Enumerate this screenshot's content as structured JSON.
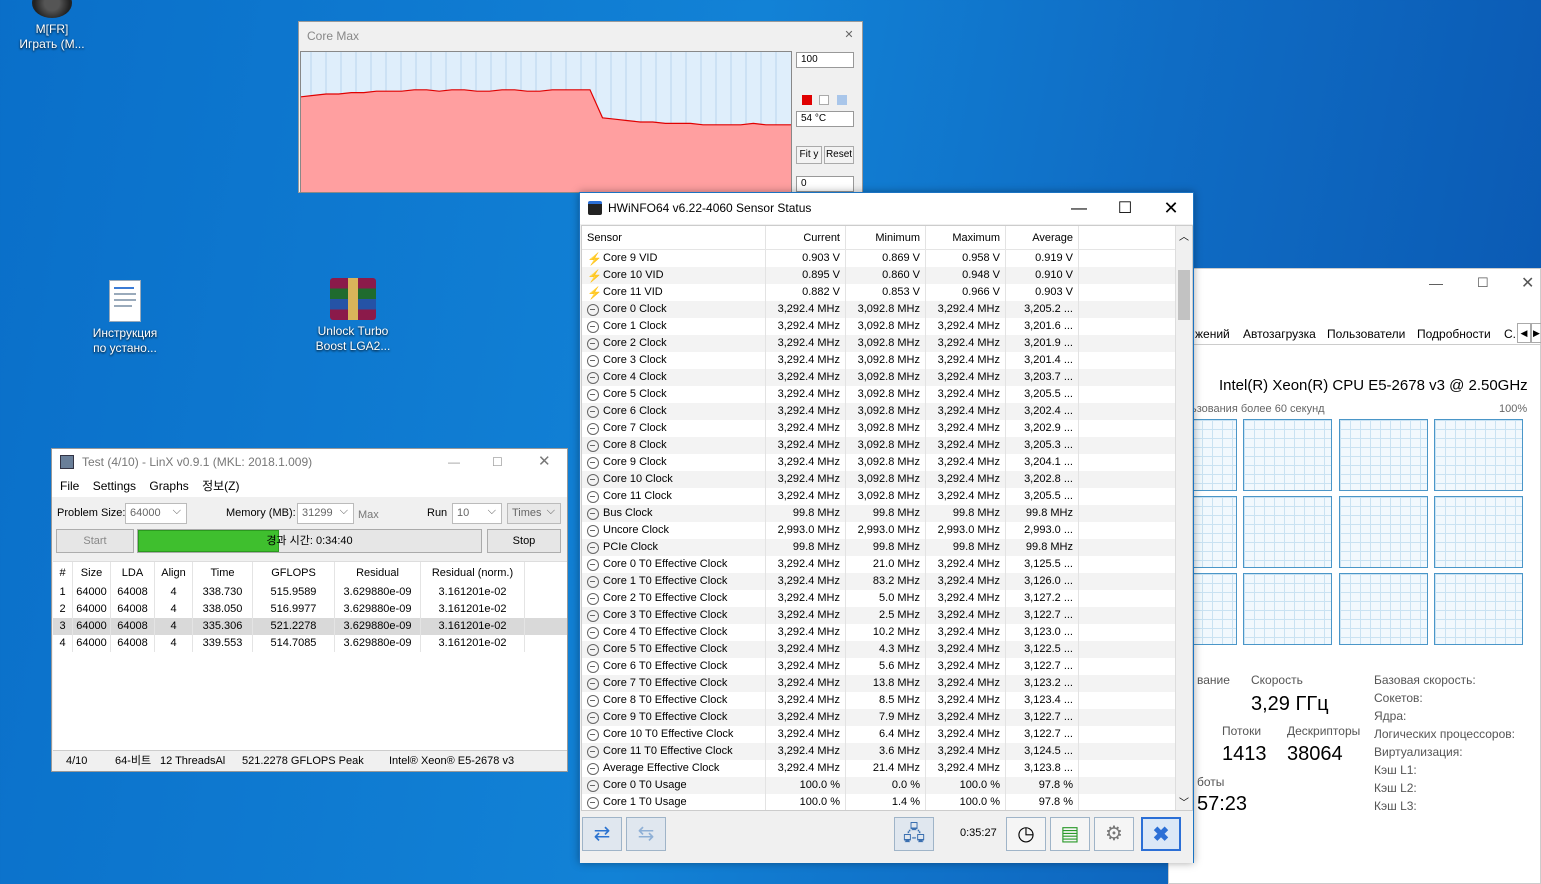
{
  "desktop": {
    "icons": [
      {
        "label_line1": "M[FR]",
        "label_line2": "Играть (М..."
      },
      {
        "label_line1": "Инструкция",
        "label_line2": "по устано..."
      },
      {
        "label_line1": "Unlock Turbo",
        "label_line2": "Boost LGA2..."
      }
    ]
  },
  "core_max": {
    "title": "Core Max",
    "max_value": "100",
    "current_temp": "54 °C",
    "min_value": "0",
    "fit_label": "Fit y",
    "reset_label": "Reset",
    "colors": {
      "line": "#e00000",
      "fill": "#ff9fa0",
      "background": "#dfeefb"
    },
    "series_levels": [
      0.68,
      0.69,
      0.7,
      0.7,
      0.71,
      0.71,
      0.72,
      0.72,
      0.72,
      0.73,
      0.73,
      0.72,
      0.73,
      0.73,
      0.72,
      0.72,
      0.73,
      0.73,
      0.72,
      0.72,
      0.73,
      0.73,
      0.73,
      0.73,
      0.53,
      0.52,
      0.51,
      0.5,
      0.5,
      0.49,
      0.49,
      0.49,
      0.48,
      0.48,
      0.48,
      0.48,
      0.49,
      0.48,
      0.48,
      0.48
    ]
  },
  "linx": {
    "title": "Test (4/10) - LinX v0.9.1 (MKL: 2018.1.009)",
    "menu": [
      "File",
      "Settings",
      "Graphs",
      "정보(Z)"
    ],
    "problem_size_label": "Problem Size:",
    "problem_size": "64000",
    "memory_label": "Memory (MB):",
    "memory": "31299",
    "max_label": "Max",
    "run_label": "Run",
    "run_value": "10",
    "run_unit": "Times",
    "start_label": "Start",
    "stop_label": "Stop",
    "progress_text": "경과 시간: 0:34:40",
    "progress_fraction": 0.41,
    "columns": [
      "#",
      "Size",
      "LDA",
      "Align",
      "Time",
      "GFLOPS",
      "Residual",
      "Residual (norm.)"
    ],
    "rows": [
      [
        "1",
        "64000",
        "64008",
        "4",
        "338.730",
        "515.9589",
        "3.629880e-09",
        "3.161201e-02"
      ],
      [
        "2",
        "64000",
        "64008",
        "4",
        "338.050",
        "516.9977",
        "3.629880e-09",
        "3.161201e-02"
      ],
      [
        "3",
        "64000",
        "64008",
        "4",
        "335.306",
        "521.2278",
        "3.629880e-09",
        "3.161201e-02"
      ],
      [
        "4",
        "64000",
        "64008",
        "4",
        "339.553",
        "514.7085",
        "3.629880e-09",
        "3.161201e-02"
      ]
    ],
    "status": [
      "4/10",
      "64-비트",
      "12 ThreadsAl",
      "521.2278 GFLOPS Peak",
      "Intel® Xeon® E5-2678 v3"
    ]
  },
  "taskmgr": {
    "tabs": [
      "жений",
      "Автозагрузка",
      "Пользователи",
      "Подробности",
      "С."
    ],
    "cpu_name": "Intel(R) Xeon(R) CPU E5-2678 v3 @ 2.50GHz",
    "usage_caption": "ьзования более 60 секунд",
    "usage_max": "100%",
    "speed_label": "Скорость",
    "speed_value": "3,29 ГГц",
    "threads_label": "Потоки",
    "threads_value": "1413",
    "handles_label": "Дескрипторы",
    "handles_value": "38064",
    "partial_label1": "вание",
    "partial_label2": "боты",
    "uptime_partial": "57:23",
    "details": [
      "Базовая скорость:",
      "Сокетов:",
      "Ядра:",
      "Логических процессоров:",
      "Виртуализация:",
      "Кэш L1:",
      "Кэш L2:",
      "Кэш L3:"
    ]
  },
  "hwinfo": {
    "title": "HWiNFO64 v6.22-4060 Sensor Status",
    "columns": [
      "Sensor",
      "Current",
      "Minimum",
      "Maximum",
      "Average"
    ],
    "rows": [
      {
        "icon": "volt",
        "name": "Core 9 VID",
        "cur": "0.903 V",
        "min": "0.869 V",
        "max": "0.958 V",
        "avg": "0.919 V"
      },
      {
        "icon": "volt",
        "name": "Core 10 VID",
        "cur": "0.895 V",
        "min": "0.860 V",
        "max": "0.948 V",
        "avg": "0.910 V"
      },
      {
        "icon": "volt",
        "name": "Core 11 VID",
        "cur": "0.882 V",
        "min": "0.853 V",
        "max": "0.966 V",
        "avg": "0.903 V"
      },
      {
        "icon": "clk",
        "name": "Core 0 Clock",
        "cur": "3,292.4 MHz",
        "min": "3,092.8 MHz",
        "max": "3,292.4 MHz",
        "avg": "3,205.2 ..."
      },
      {
        "icon": "clk",
        "name": "Core 1 Clock",
        "cur": "3,292.4 MHz",
        "min": "3,092.8 MHz",
        "max": "3,292.4 MHz",
        "avg": "3,201.6 ..."
      },
      {
        "icon": "clk",
        "name": "Core 2 Clock",
        "cur": "3,292.4 MHz",
        "min": "3,092.8 MHz",
        "max": "3,292.4 MHz",
        "avg": "3,201.9 ..."
      },
      {
        "icon": "clk",
        "name": "Core 3 Clock",
        "cur": "3,292.4 MHz",
        "min": "3,092.8 MHz",
        "max": "3,292.4 MHz",
        "avg": "3,201.4 ..."
      },
      {
        "icon": "clk",
        "name": "Core 4 Clock",
        "cur": "3,292.4 MHz",
        "min": "3,092.8 MHz",
        "max": "3,292.4 MHz",
        "avg": "3,203.7 ..."
      },
      {
        "icon": "clk",
        "name": "Core 5 Clock",
        "cur": "3,292.4 MHz",
        "min": "3,092.8 MHz",
        "max": "3,292.4 MHz",
        "avg": "3,205.5 ..."
      },
      {
        "icon": "clk",
        "name": "Core 6 Clock",
        "cur": "3,292.4 MHz",
        "min": "3,092.8 MHz",
        "max": "3,292.4 MHz",
        "avg": "3,202.4 ..."
      },
      {
        "icon": "clk",
        "name": "Core 7 Clock",
        "cur": "3,292.4 MHz",
        "min": "3,092.8 MHz",
        "max": "3,292.4 MHz",
        "avg": "3,202.9 ..."
      },
      {
        "icon": "clk",
        "name": "Core 8 Clock",
        "cur": "3,292.4 MHz",
        "min": "3,092.8 MHz",
        "max": "3,292.4 MHz",
        "avg": "3,205.3 ..."
      },
      {
        "icon": "clk",
        "name": "Core 9 Clock",
        "cur": "3,292.4 MHz",
        "min": "3,092.8 MHz",
        "max": "3,292.4 MHz",
        "avg": "3,204.1 ..."
      },
      {
        "icon": "clk",
        "name": "Core 10 Clock",
        "cur": "3,292.4 MHz",
        "min": "3,092.8 MHz",
        "max": "3,292.4 MHz",
        "avg": "3,202.8 ..."
      },
      {
        "icon": "clk",
        "name": "Core 11 Clock",
        "cur": "3,292.4 MHz",
        "min": "3,092.8 MHz",
        "max": "3,292.4 MHz",
        "avg": "3,205.5 ..."
      },
      {
        "icon": "clk",
        "name": "Bus Clock",
        "cur": "99.8 MHz",
        "min": "99.8 MHz",
        "max": "99.8 MHz",
        "avg": "99.8 MHz"
      },
      {
        "icon": "clk",
        "name": "Uncore Clock",
        "cur": "2,993.0 MHz",
        "min": "2,993.0 MHz",
        "max": "2,993.0 MHz",
        "avg": "2,993.0 ..."
      },
      {
        "icon": "clk",
        "name": "PCIe Clock",
        "cur": "99.8 MHz",
        "min": "99.8 MHz",
        "max": "99.8 MHz",
        "avg": "99.8 MHz"
      },
      {
        "icon": "clk",
        "name": "Core 0 T0 Effective Clock",
        "cur": "3,292.4 MHz",
        "min": "21.0 MHz",
        "max": "3,292.4 MHz",
        "avg": "3,125.5 ..."
      },
      {
        "icon": "clk",
        "name": "Core 1 T0 Effective Clock",
        "cur": "3,292.4 MHz",
        "min": "83.2 MHz",
        "max": "3,292.4 MHz",
        "avg": "3,126.0 ..."
      },
      {
        "icon": "clk",
        "name": "Core 2 T0 Effective Clock",
        "cur": "3,292.4 MHz",
        "min": "5.0 MHz",
        "max": "3,292.4 MHz",
        "avg": "3,127.2 ..."
      },
      {
        "icon": "clk",
        "name": "Core 3 T0 Effective Clock",
        "cur": "3,292.4 MHz",
        "min": "2.5 MHz",
        "max": "3,292.4 MHz",
        "avg": "3,122.7 ..."
      },
      {
        "icon": "clk",
        "name": "Core 4 T0 Effective Clock",
        "cur": "3,292.4 MHz",
        "min": "10.2 MHz",
        "max": "3,292.4 MHz",
        "avg": "3,123.0 ..."
      },
      {
        "icon": "clk",
        "name": "Core 5 T0 Effective Clock",
        "cur": "3,292.4 MHz",
        "min": "4.3 MHz",
        "max": "3,292.4 MHz",
        "avg": "3,122.5 ..."
      },
      {
        "icon": "clk",
        "name": "Core 6 T0 Effective Clock",
        "cur": "3,292.4 MHz",
        "min": "5.6 MHz",
        "max": "3,292.4 MHz",
        "avg": "3,122.7 ..."
      },
      {
        "icon": "clk",
        "name": "Core 7 T0 Effective Clock",
        "cur": "3,292.4 MHz",
        "min": "13.8 MHz",
        "max": "3,292.4 MHz",
        "avg": "3,123.2 ..."
      },
      {
        "icon": "clk",
        "name": "Core 8 T0 Effective Clock",
        "cur": "3,292.4 MHz",
        "min": "8.5 MHz",
        "max": "3,292.4 MHz",
        "avg": "3,123.4 ..."
      },
      {
        "icon": "clk",
        "name": "Core 9 T0 Effective Clock",
        "cur": "3,292.4 MHz",
        "min": "7.9 MHz",
        "max": "3,292.4 MHz",
        "avg": "3,122.7 ..."
      },
      {
        "icon": "clk",
        "name": "Core 10 T0 Effective Clock",
        "cur": "3,292.4 MHz",
        "min": "6.4 MHz",
        "max": "3,292.4 MHz",
        "avg": "3,122.7 ..."
      },
      {
        "icon": "clk",
        "name": "Core 11 T0 Effective Clock",
        "cur": "3,292.4 MHz",
        "min": "3.6 MHz",
        "max": "3,292.4 MHz",
        "avg": "3,124.5 ..."
      },
      {
        "icon": "clk",
        "name": "Average Effective Clock",
        "cur": "3,292.4 MHz",
        "min": "21.4 MHz",
        "max": "3,292.4 MHz",
        "avg": "3,123.8 ..."
      },
      {
        "icon": "clk",
        "name": "Core 0 T0 Usage",
        "cur": "100.0 %",
        "min": "0.0 %",
        "max": "100.0 %",
        "avg": "97.8 %"
      },
      {
        "icon": "clk",
        "name": "Core 1 T0 Usage",
        "cur": "100.0 %",
        "min": "1.4 %",
        "max": "100.0 %",
        "avg": "97.8 %"
      }
    ],
    "timer": "0:35:27"
  }
}
